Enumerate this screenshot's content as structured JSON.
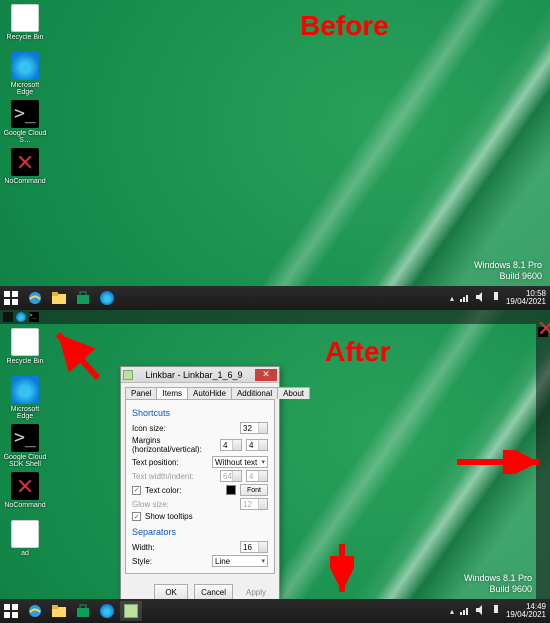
{
  "labels": {
    "before": "Before",
    "after": "After"
  },
  "watermark": {
    "line1": "Windows 8.1 Pro",
    "line2": "Build 9600"
  },
  "clock": {
    "before": {
      "time": "10:58",
      "date": "19/04/2021"
    },
    "after": {
      "time": "14:49",
      "date": "19/04/2021"
    }
  },
  "desktop_icons": {
    "before": [
      {
        "name": "recycle-bin",
        "label": "Recycle Bin",
        "glyph": "g-doc"
      },
      {
        "name": "microsoft-edge",
        "label": "Microsoft Edge",
        "glyph": "g-edge"
      },
      {
        "name": "google-cloud-sdk",
        "label": "Google Cloud S…",
        "glyph": "g-cmd"
      },
      {
        "name": "nocommand",
        "label": "NoCommand",
        "glyph": "g-x"
      }
    ],
    "after": [
      {
        "name": "recycle-bin",
        "label": "Recycle Bin",
        "glyph": "g-doc"
      },
      {
        "name": "microsoft-edge",
        "label": "Microsoft Edge",
        "glyph": "g-edge"
      },
      {
        "name": "google-cloud-sdk",
        "label": "Google Cloud SDK Shell",
        "glyph": "g-cmd"
      },
      {
        "name": "nocommand",
        "label": "NoCommand",
        "glyph": "g-x"
      },
      {
        "name": "text-file",
        "label": "ad",
        "glyph": "g-doc"
      }
    ]
  },
  "taskbar_apps": {
    "before": [
      "start",
      "ie",
      "file-explorer",
      "store",
      "edge"
    ],
    "after": [
      "start",
      "ie",
      "file-explorer",
      "store",
      "edge",
      "linkbar-running"
    ]
  },
  "tray_icons": [
    "chevron-up",
    "network",
    "volume",
    "action-center"
  ],
  "linkbar_top_items": [
    "app-black",
    "edge",
    "cmd"
  ],
  "linkbar_right_items": [
    "nocommand"
  ],
  "dialog": {
    "title": "Linkbar - Linkbar_1_6_9",
    "tabs": [
      "Panel",
      "Items",
      "AutoHide",
      "Additional",
      "About"
    ],
    "active_tab": "Items",
    "sections": {
      "shortcuts": "Shortcuts",
      "separators": "Separators"
    },
    "fields": {
      "icon_size": {
        "label": "Icon size:",
        "value": "32"
      },
      "margins": {
        "label": "Margins (horizontal/vertical):",
        "h": "4",
        "v": "4"
      },
      "text_position": {
        "label": "Text position:",
        "value": "Without text"
      },
      "text_width": {
        "label": "Text width/indent:",
        "w": "64",
        "i": "4",
        "disabled": true
      },
      "text_color": {
        "label": "Text color:",
        "checked": true,
        "swatch": "#000000",
        "font_btn": "Font"
      },
      "glow_size": {
        "label": "Glow size:",
        "value": "12",
        "disabled": true
      },
      "show_tooltips": {
        "label": "Show tooltips",
        "checked": true
      },
      "sep_width": {
        "label": "Width:",
        "value": "16"
      },
      "sep_style": {
        "label": "Style:",
        "value": "Line"
      }
    },
    "buttons": {
      "ok": "OK",
      "cancel": "Cancel",
      "apply": "Apply"
    }
  }
}
